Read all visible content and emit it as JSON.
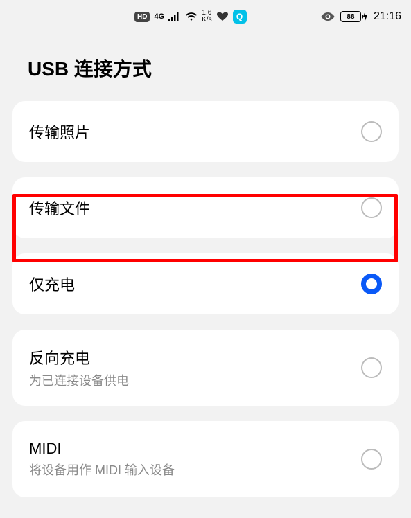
{
  "status_bar": {
    "hd": "HD",
    "network_4g": "4G",
    "speed_value": "1.6",
    "speed_unit": "K/s",
    "q_badge": "Q",
    "battery_percent": "88",
    "charging": true,
    "time": "21:16"
  },
  "header": {
    "title": "USB 连接方式"
  },
  "options": [
    {
      "label": "传输照片",
      "description": "",
      "selected": false
    },
    {
      "label": "传输文件",
      "description": "",
      "selected": false
    },
    {
      "label": "仅充电",
      "description": "",
      "selected": true
    },
    {
      "label": "反向充电",
      "description": "为已连接设备供电",
      "selected": false
    },
    {
      "label": "MIDI",
      "description": "将设备用作 MIDI 输入设备",
      "selected": false
    }
  ],
  "highlight": {
    "option_index": 1
  }
}
